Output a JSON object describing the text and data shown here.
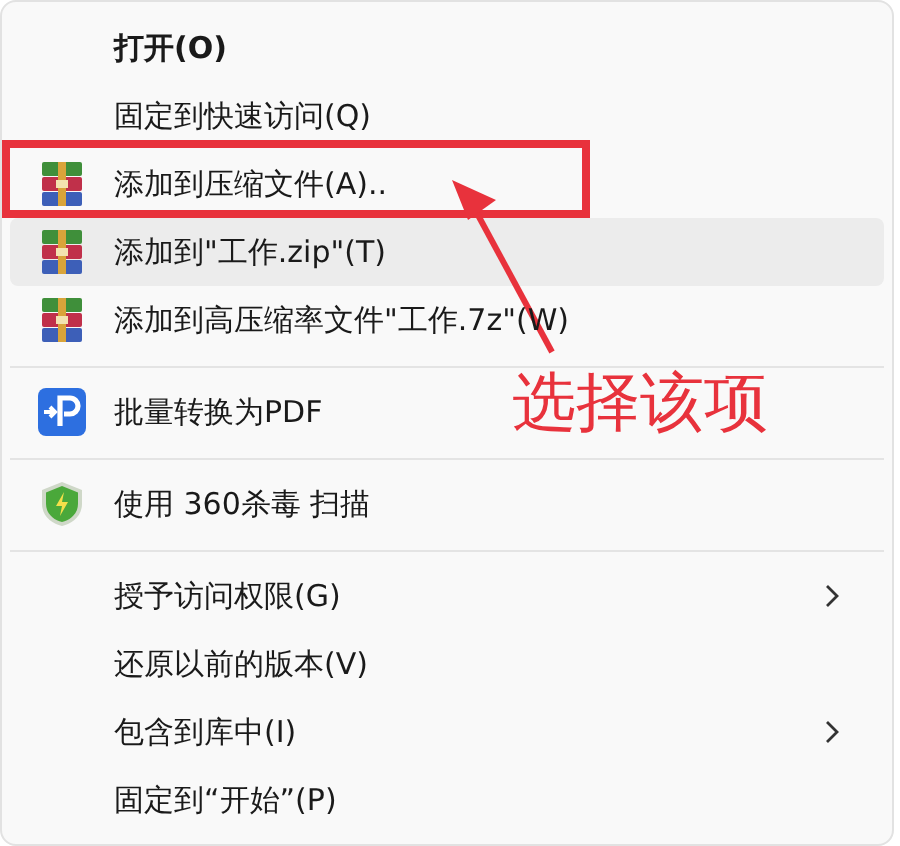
{
  "menu": {
    "sections": [
      {
        "items": [
          {
            "label": "打开(O)",
            "kind": "plain",
            "default": true,
            "selected": false,
            "submenu": false
          },
          {
            "label": "固定到快速访问(Q)",
            "kind": "plain",
            "default": false,
            "selected": false,
            "submenu": false
          },
          {
            "label": "添加到压缩文件(A)..",
            "kind": "archive",
            "default": false,
            "selected": false,
            "submenu": false
          },
          {
            "label": "添加到\"工作.zip\"(T)",
            "kind": "archive",
            "default": false,
            "selected": true,
            "submenu": false
          },
          {
            "label": "添加到高压缩率文件\"工作.7z\"(W)",
            "kind": "archive",
            "default": false,
            "selected": false,
            "submenu": false
          }
        ]
      },
      {
        "items": [
          {
            "label": "批量转换为PDF",
            "kind": "pdf",
            "default": false,
            "selected": false,
            "submenu": false
          }
        ]
      },
      {
        "items": [
          {
            "label": "使用 360杀毒 扫描",
            "kind": "shield",
            "default": false,
            "selected": false,
            "submenu": false
          }
        ]
      },
      {
        "items": [
          {
            "label": "授予访问权限(G)",
            "kind": "plain",
            "default": false,
            "selected": false,
            "submenu": true
          },
          {
            "label": "还原以前的版本(V)",
            "kind": "plain",
            "default": false,
            "selected": false,
            "submenu": false
          },
          {
            "label": "包含到库中(I)",
            "kind": "plain",
            "default": false,
            "selected": false,
            "submenu": true
          },
          {
            "label": "固定到“开始”(P)",
            "kind": "plain",
            "default": false,
            "selected": false,
            "submenu": false
          }
        ]
      }
    ]
  },
  "annotation": {
    "label": "选择该项"
  }
}
